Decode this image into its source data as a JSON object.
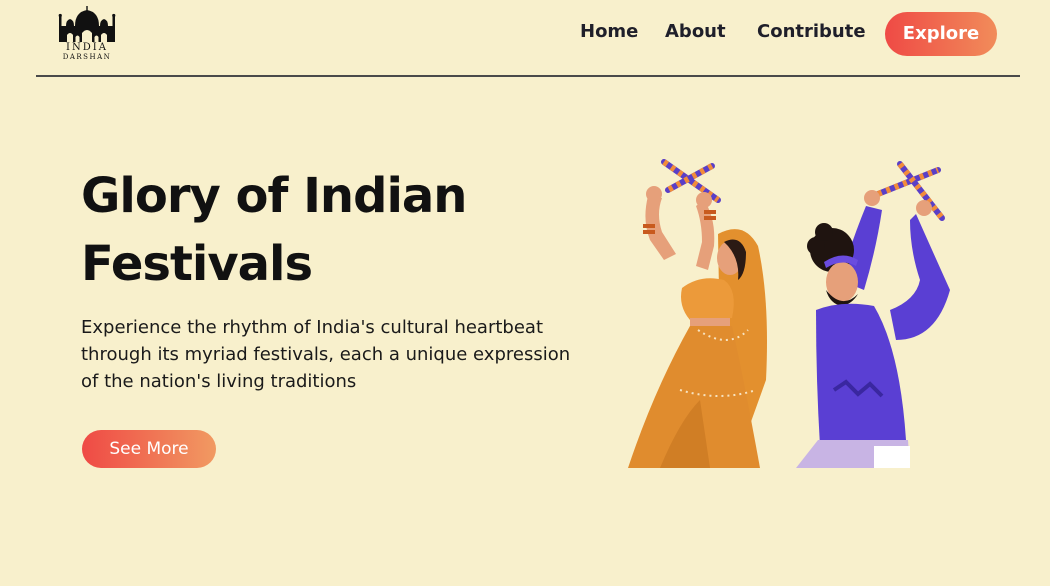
{
  "header": {
    "logo": {
      "line1": "INDIA",
      "line2": "DARSHAN",
      "icon": "taj-mahal-icon"
    },
    "nav": [
      {
        "label": "Home"
      },
      {
        "label": "About"
      },
      {
        "label": "Contribute"
      }
    ],
    "explore_label": "Explore"
  },
  "hero": {
    "title_line1": "Glory of Indian",
    "title_line2": "Festivals",
    "description": "Experience the rhythm of India's cultural heartbeat through its myriad festivals, each a unique expression of the nation's living traditions",
    "button_label": "See More",
    "illustration": "dandiya-dancers-illustration"
  },
  "colors": {
    "background": "#f8f0cc",
    "accent_start": "#ef4a45",
    "accent_end": "#f18c5a",
    "text": "#111111"
  }
}
